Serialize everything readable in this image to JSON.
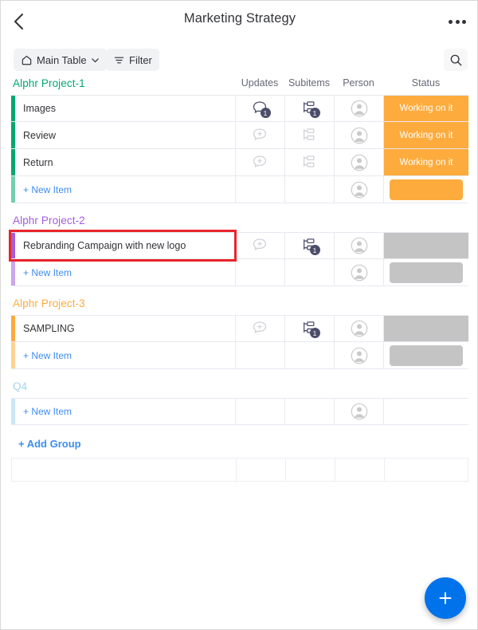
{
  "header": {
    "title": "Marketing Strategy",
    "back_icon": "chevron-left-icon",
    "more_icon": "more-horizontal-icon"
  },
  "toolbar": {
    "view_label": "Main Table",
    "view_icon": "home-icon",
    "view_chevron_icon": "chevron-down-icon",
    "filter_label": "Filter",
    "filter_icon": "filter-icon",
    "search_icon": "search-icon"
  },
  "columns": [
    {
      "label": "Updates"
    },
    {
      "label": "Subitems"
    },
    {
      "label": "Person"
    },
    {
      "label": "Status"
    }
  ],
  "colors": {
    "green": "#00a870",
    "purple": "#a25ddc",
    "orange_group": "#fdab3d",
    "light_blue": "#9fd5ef",
    "status_orange": "#fdab3d",
    "status_gray": "#c4c4c4",
    "accent_blue": "#0073ea",
    "link_blue": "#3e8df0",
    "highlight_red": "#e8252a"
  },
  "groups": [
    {
      "title": "Alphr Project-1",
      "color": "#00a870",
      "rows": [
        {
          "name": "Images",
          "updates_icon": "comment-icon",
          "updates_count": "1",
          "subitems_icon": "subitems-icon",
          "subitems_count": "1",
          "person_icon": "avatar-icon",
          "status_label": "Working on it",
          "status_color": "#fdab3d"
        },
        {
          "name": "Review",
          "updates_icon": "comment-add-icon",
          "updates_count": "",
          "subitems_icon": "subitems-icon",
          "subitems_count": "",
          "person_icon": "avatar-icon",
          "status_label": "Working on it",
          "status_color": "#fdab3d"
        },
        {
          "name": "Return",
          "updates_icon": "comment-add-icon",
          "updates_count": "",
          "subitems_icon": "subitems-icon",
          "subitems_count": "",
          "person_icon": "avatar-icon",
          "status_label": "Working on it",
          "status_color": "#fdab3d"
        }
      ],
      "new_item_label": "+ New Item",
      "new_item_status_color": "#fdab3d"
    },
    {
      "title": "Alphr Project-2",
      "color": "#a25ddc",
      "rows": [
        {
          "name": "Rebranding Campaign with new logo",
          "updates_icon": "comment-add-icon",
          "updates_count": "",
          "subitems_icon": "subitems-icon",
          "subitems_count": "1",
          "person_icon": "avatar-icon",
          "status_label": "",
          "status_color": "#c4c4c4"
        }
      ],
      "new_item_label": "+ New Item",
      "new_item_status_color": "#c4c4c4"
    },
    {
      "title": "Alphr Project-3",
      "color": "#fdab3d",
      "rows": [
        {
          "name": "SAMPLING",
          "updates_icon": "comment-add-icon",
          "updates_count": "",
          "subitems_icon": "subitems-icon",
          "subitems_count": "1",
          "person_icon": "avatar-icon",
          "status_label": "",
          "status_color": "#c4c4c4"
        }
      ],
      "new_item_label": "+ New Item",
      "new_item_status_color": "#c4c4c4"
    },
    {
      "title": "Q4",
      "color": "#9fd5ef",
      "rows": [],
      "new_item_label": "+ New Item",
      "new_item_status_color": ""
    }
  ],
  "add_group_label": "+ Add Group",
  "fab": {
    "icon": "plus-icon"
  },
  "annotation": {
    "type": "highlight-rectangle",
    "color": "#e8252a",
    "target": "Rebranding Campaign with new logo"
  }
}
